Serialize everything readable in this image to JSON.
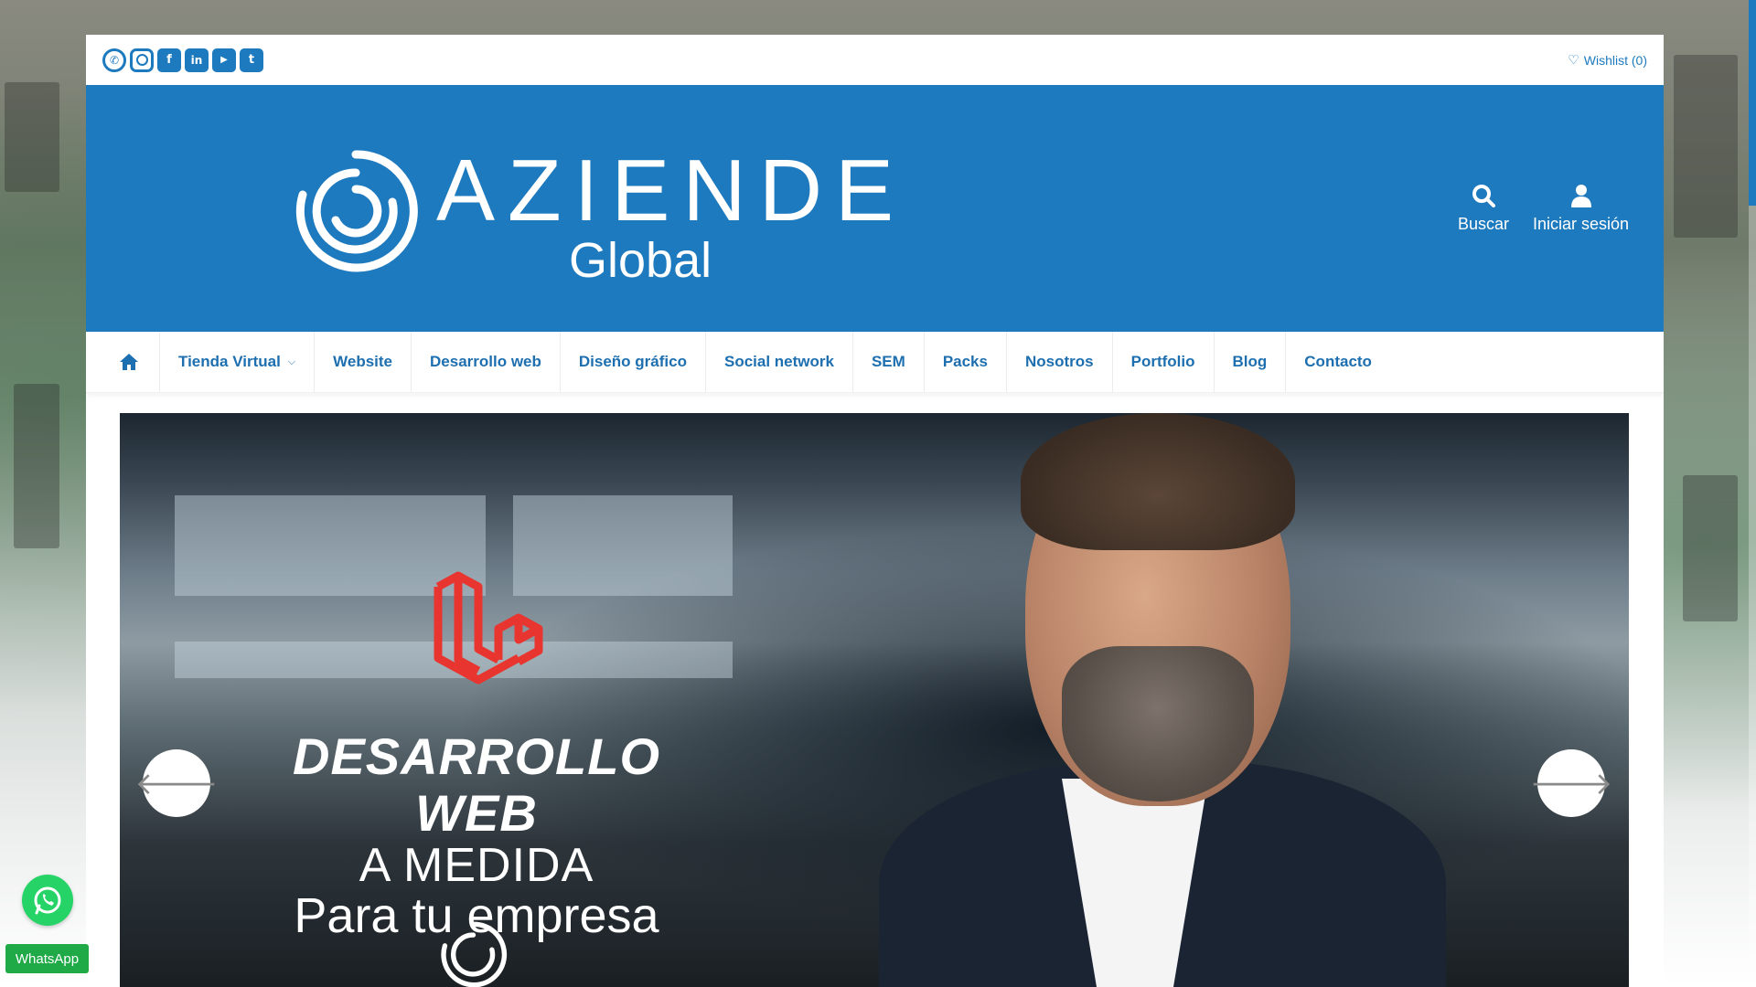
{
  "topbar": {
    "socials": [
      {
        "name": "whatsapp-icon",
        "glyph": "✆"
      },
      {
        "name": "instagram-icon",
        "glyph": ""
      },
      {
        "name": "facebook-icon",
        "glyph": "f"
      },
      {
        "name": "linkedin-icon",
        "glyph": "in"
      },
      {
        "name": "youtube-icon",
        "glyph": "▶"
      },
      {
        "name": "twitter-icon",
        "glyph": "t"
      }
    ],
    "wishlist_label": "Wishlist (0)"
  },
  "header": {
    "logo_main": "AZIENDE",
    "logo_sub": "Global",
    "search_label": "Buscar",
    "login_label": "Iniciar sesión"
  },
  "nav": {
    "items": [
      "Tienda Virtual",
      "Website",
      "Desarrollo web",
      "Diseño gráfico",
      "Social network",
      "SEM",
      "Packs",
      "Nosotros",
      "Portfolio",
      "Blog",
      "Contacto"
    ]
  },
  "slider": {
    "line1": "DESARROLLO WEB",
    "line2": "A MEDIDA",
    "line3": "Para tu empresa"
  },
  "floating": {
    "whatsapp_label": "WhatsApp"
  },
  "colors": {
    "brand_blue": "#1e7abe",
    "whatsapp_green": "#25d366",
    "laravel_red": "#e8352f"
  }
}
